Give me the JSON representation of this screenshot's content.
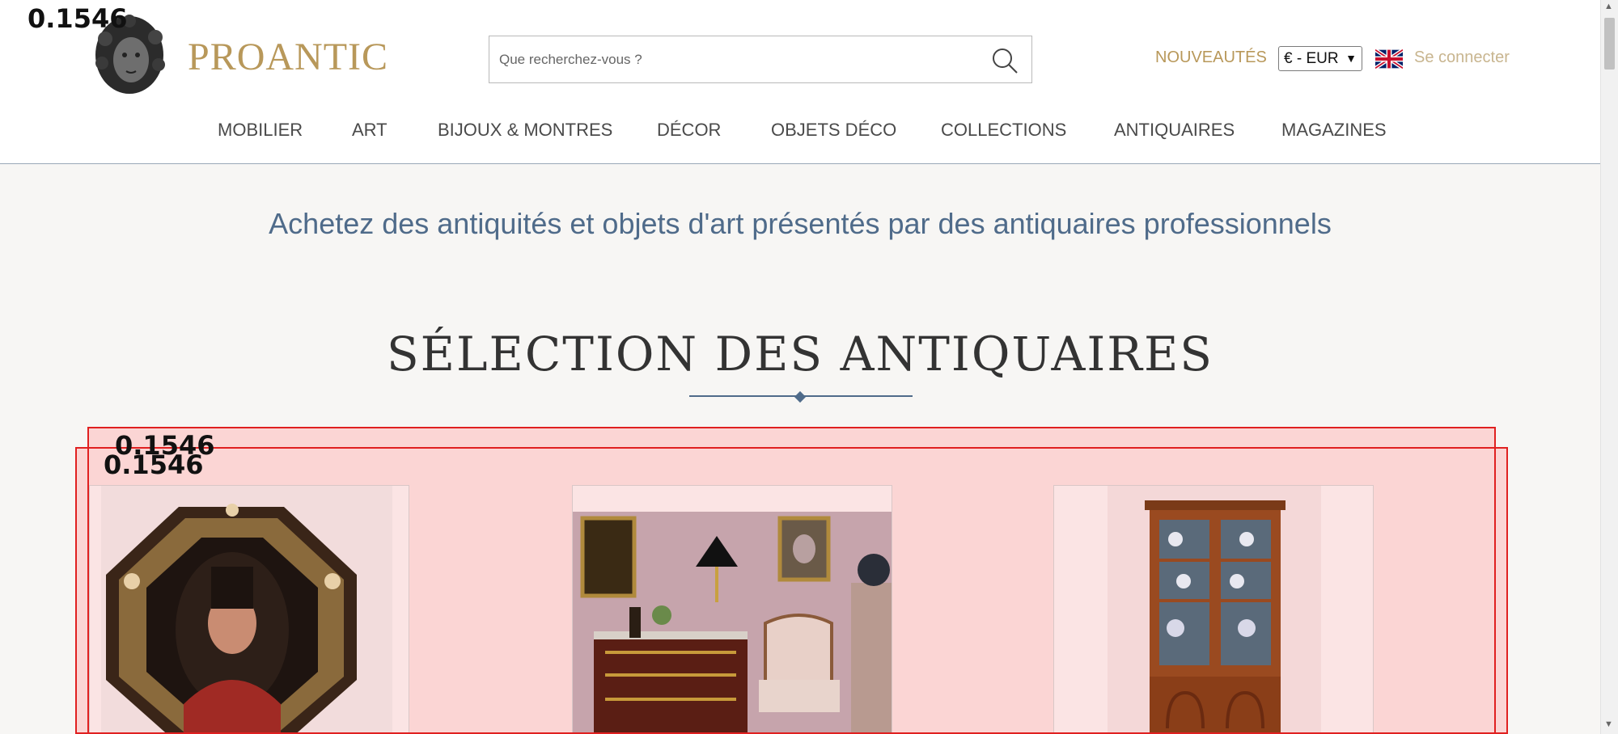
{
  "header": {
    "logo_text": "PROANTIC",
    "search_placeholder": "Que recherchez-vous ?",
    "nouveautes": "NOUVEAUTÉS",
    "currency": "€ - EUR",
    "login": "Se connecter"
  },
  "nav": [
    "MOBILIER",
    "ART",
    "BIJOUX & MONTRES",
    "DÉCOR",
    "OBJETS DÉCO",
    "COLLECTIONS",
    "ANTIQUAIRES",
    "MAGAZINES"
  ],
  "tagline": "Achetez des antiquités et objets d'art présentés par des antiquaires professionnels",
  "section_title": "SÉLECTION DES ANTIQUAIRES",
  "overlay_scores": [
    "0.1546",
    "0.1546",
    "0.1546"
  ],
  "colors": {
    "brand_gold": "#b8985a",
    "accent_blue": "#4f6b8a",
    "overlay_red": "#e02020"
  },
  "icons": {
    "search": "search-icon",
    "flag": "uk-flag-icon"
  }
}
